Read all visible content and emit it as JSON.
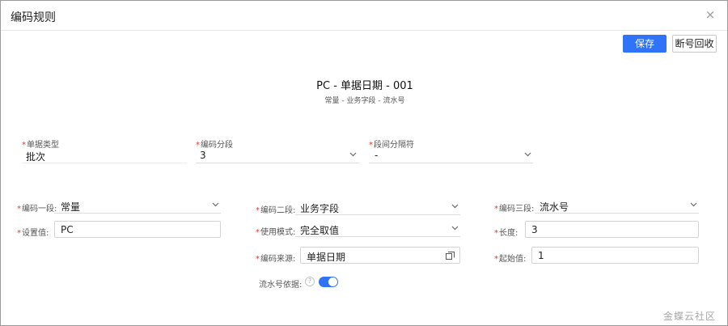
{
  "dialog": {
    "title": "编码规则",
    "close_glyph": "×"
  },
  "toolbar": {
    "save_label": "保存",
    "reclaim_label": "断号回收"
  },
  "preview": {
    "code": "PC - 单据日期 - 001",
    "description": "常量 - 业务字段 - 流水号"
  },
  "top_fields": {
    "doc_type": {
      "label": "单据类型",
      "value": "批次"
    },
    "segment_count": {
      "label": "编码分段",
      "value": "3"
    },
    "separator": {
      "label": "段间分隔符",
      "value": "-"
    }
  },
  "segment1": {
    "label": "编码一段:",
    "value": "常量",
    "set_value_label": "设置值:",
    "set_value": "PC"
  },
  "segment2": {
    "label": "编码二段:",
    "value": "业务字段",
    "mode_label": "使用模式:",
    "mode_value": "完全取值",
    "source_label": "编码来源:",
    "source_value": "单据日期",
    "serial_basis_label": "流水号依据:",
    "serial_basis_on": true
  },
  "segment3": {
    "label": "编码三段:",
    "value": "流水号",
    "length_label": "长度:",
    "length_value": "3",
    "start_label": "起始值:",
    "start_value": "1"
  },
  "watermark": "金蝶云社区",
  "colors": {
    "primary": "#2f73f6",
    "required": "#e53935"
  }
}
